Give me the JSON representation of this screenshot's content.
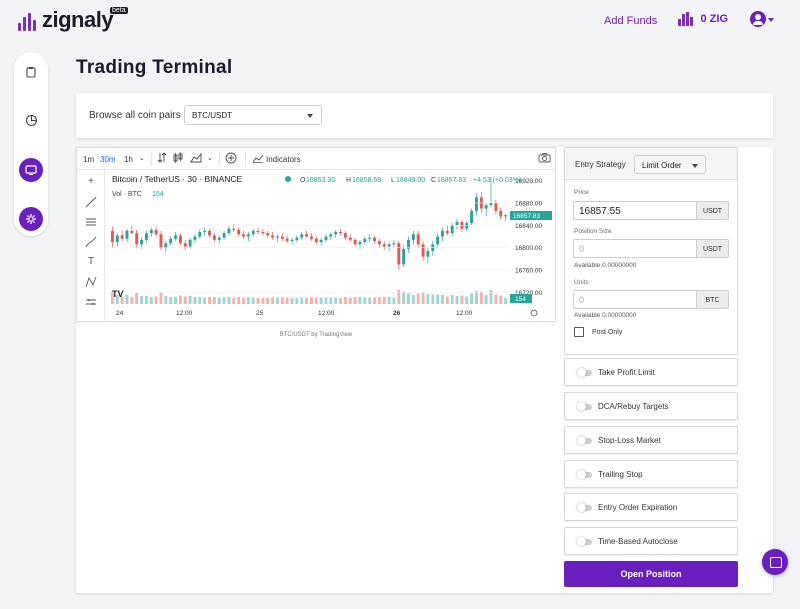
{
  "app": {
    "logo_text": "zignaly",
    "beta_label": "beta",
    "add_funds_label": "Add Funds",
    "balance": "0 ZIG"
  },
  "colors": {
    "brand": "#6a1fbf",
    "candle_up": "#26a69a",
    "candle_down": "#ef5350"
  },
  "sidebar": {
    "items": [
      {
        "icon": "clipboard-icon"
      },
      {
        "icon": "pie-chart-icon"
      },
      {
        "icon": "monitor-icon",
        "active": true
      },
      {
        "icon": "gear-icon",
        "active": true
      }
    ]
  },
  "page_title": "Trading Terminal",
  "pairs": {
    "label": "Browse all coin pairs",
    "selected": "BTC/USDT"
  },
  "chart_toolbar": {
    "intervals": [
      "1m",
      "30m",
      "1h"
    ],
    "active_interval": "30m",
    "indicators_label": "Indicators"
  },
  "chart_data": {
    "type": "bar",
    "title": "Bitcoin / TetherUS · 30 · BINANCE",
    "ohlc": {
      "o_label": "O",
      "o": "16853.30",
      "h_label": "H",
      "h": "16858.59",
      "l_label": "L",
      "l": "16849.00",
      "c_label": "C",
      "c": "16857.83",
      "change": "+4.53 (+0.03%)"
    },
    "volume_label": "Vol · BTC",
    "volume_value": "154",
    "y_ticks": [
      "16920.00",
      "16880.00",
      "16840.00",
      "16800.00",
      "16760.00",
      "16720.00"
    ],
    "ylim": [
      16710,
      16930
    ],
    "x_ticks": [
      "24",
      "12:00",
      "25",
      "12:00",
      "26",
      "12:00"
    ],
    "last_price_label": "16857.83",
    "last_volume_label": "154",
    "candles": [
      [
        16830,
        16838,
        16800,
        16810
      ],
      [
        16810,
        16826,
        16802,
        16822
      ],
      [
        16822,
        16830,
        16812,
        16816
      ],
      [
        16816,
        16834,
        16810,
        16830
      ],
      [
        16830,
        16840,
        16824,
        16826
      ],
      [
        16826,
        16832,
        16800,
        16806
      ],
      [
        16806,
        16818,
        16798,
        16814
      ],
      [
        16814,
        16830,
        16810,
        16826
      ],
      [
        16826,
        16836,
        16820,
        16832
      ],
      [
        16832,
        16838,
        16820,
        16824
      ],
      [
        16824,
        16830,
        16796,
        16800
      ],
      [
        16800,
        16812,
        16792,
        16808
      ],
      [
        16808,
        16820,
        16804,
        16816
      ],
      [
        16816,
        16828,
        16812,
        16822
      ],
      [
        16822,
        16826,
        16804,
        16808
      ],
      [
        16808,
        16814,
        16796,
        16802
      ],
      [
        16802,
        16818,
        16798,
        16814
      ],
      [
        16814,
        16824,
        16808,
        16820
      ],
      [
        16820,
        16832,
        16816,
        16828
      ],
      [
        16828,
        16836,
        16822,
        16830
      ],
      [
        16830,
        16834,
        16818,
        16822
      ],
      [
        16822,
        16826,
        16810,
        16814
      ],
      [
        16814,
        16822,
        16808,
        16818
      ],
      [
        16818,
        16830,
        16814,
        16826
      ],
      [
        16826,
        16838,
        16822,
        16834
      ],
      [
        16834,
        16842,
        16828,
        16832
      ],
      [
        16832,
        16836,
        16820,
        16824
      ],
      [
        16824,
        16830,
        16816,
        16820
      ],
      [
        16820,
        16828,
        16812,
        16824
      ],
      [
        16824,
        16834,
        16820,
        16830
      ],
      [
        16830,
        16836,
        16824,
        16828
      ],
      [
        16828,
        16834,
        16822,
        16826
      ],
      [
        16826,
        16830,
        16818,
        16822
      ],
      [
        16822,
        16828,
        16814,
        16818
      ],
      [
        16818,
        16824,
        16810,
        16820
      ],
      [
        16820,
        16826,
        16812,
        16816
      ],
      [
        16816,
        16822,
        16808,
        16812
      ],
      [
        16812,
        16818,
        16806,
        16814
      ],
      [
        16814,
        16822,
        16810,
        16818
      ],
      [
        16818,
        16828,
        16814,
        16824
      ],
      [
        16824,
        16830,
        16818,
        16820
      ],
      [
        16820,
        16826,
        16812,
        16816
      ],
      [
        16816,
        16820,
        16806,
        16810
      ],
      [
        16810,
        16818,
        16804,
        16814
      ],
      [
        16814,
        16824,
        16810,
        16820
      ],
      [
        16820,
        16828,
        16814,
        16824
      ],
      [
        16824,
        16832,
        16818,
        16828
      ],
      [
        16828,
        16834,
        16822,
        16826
      ],
      [
        16826,
        16830,
        16814,
        16818
      ],
      [
        16818,
        16824,
        16810,
        16814
      ],
      [
        16814,
        16818,
        16802,
        16806
      ],
      [
        16806,
        16814,
        16798,
        16810
      ],
      [
        16810,
        16820,
        16806,
        16816
      ],
      [
        16816,
        16824,
        16810,
        16818
      ],
      [
        16818,
        16822,
        16808,
        16812
      ],
      [
        16812,
        16816,
        16800,
        16806
      ],
      [
        16806,
        16812,
        16796,
        16802
      ],
      [
        16802,
        16810,
        16794,
        16806
      ],
      [
        16806,
        16814,
        16800,
        16808
      ],
      [
        16808,
        16812,
        16760,
        16770
      ],
      [
        16770,
        16804,
        16766,
        16798
      ],
      [
        16798,
        16820,
        16790,
        16814
      ],
      [
        16814,
        16830,
        16806,
        16824
      ],
      [
        16824,
        16830,
        16800,
        16806
      ],
      [
        16806,
        16812,
        16776,
        16784
      ],
      [
        16784,
        16800,
        16772,
        16794
      ],
      [
        16794,
        16812,
        16786,
        16806
      ],
      [
        16806,
        16826,
        16800,
        16820
      ],
      [
        16820,
        16836,
        16812,
        16830
      ],
      [
        16830,
        16840,
        16822,
        16826
      ],
      [
        16826,
        16844,
        16820,
        16840
      ],
      [
        16840,
        16852,
        16832,
        16846
      ],
      [
        16846,
        16850,
        16828,
        16834
      ],
      [
        16834,
        16848,
        16830,
        16844
      ],
      [
        16844,
        16870,
        16840,
        16866
      ],
      [
        16866,
        16898,
        16858,
        16890
      ],
      [
        16890,
        16900,
        16862,
        16870
      ],
      [
        16870,
        16880,
        16856,
        16876
      ],
      [
        16876,
        16926,
        16872,
        16880
      ],
      [
        16880,
        16886,
        16860,
        16866
      ],
      [
        16866,
        16872,
        16850,
        16856
      ],
      [
        16856,
        16860,
        16848,
        16858
      ]
    ]
  },
  "chart_caption": "BTC/USDT by TradingView",
  "order": {
    "entry_strategy_label": "Entry Strategy",
    "entry_strategy_value": "Limit Order",
    "price_label": "Price",
    "price_value": "16857.55",
    "price_unit": "USDT",
    "size_label": "Position Size",
    "size_placeholder": "0",
    "size_unit": "USDT",
    "size_available": "Available 0.00000000",
    "units_label": "Units",
    "units_placeholder": "0",
    "units_unit": "BTC",
    "units_available": "Available 0.00000000",
    "post_only_label": "Post Only"
  },
  "toggles": [
    {
      "label": "Take Profit Limit"
    },
    {
      "label": "DCA/Rebuy Targets"
    },
    {
      "label": "Stop-Loss Market"
    },
    {
      "label": "Trailing Stop"
    },
    {
      "label": "Entry Order Expiration"
    },
    {
      "label": "Time-Based Autoclose"
    }
  ],
  "open_position_label": "Open Position"
}
